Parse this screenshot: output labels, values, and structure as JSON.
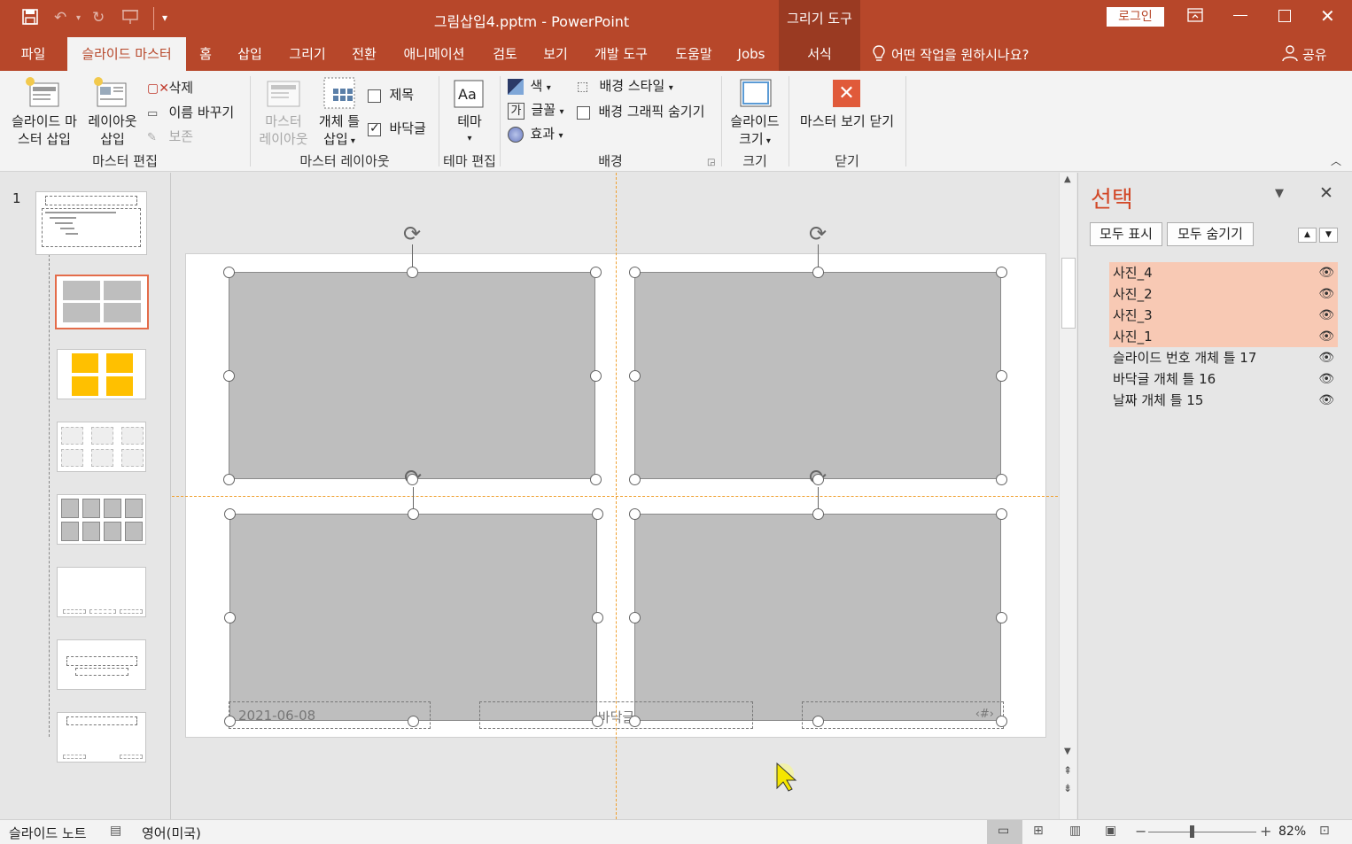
{
  "window": {
    "title": "그림삽입4.pptm  -  PowerPoint",
    "login_label": "로그인",
    "context_group": "그리기 도구"
  },
  "tabs": [
    "파일",
    "슬라이드 마스터",
    "홈",
    "삽입",
    "그리기",
    "전환",
    "애니메이션",
    "검토",
    "보기",
    "개발 도구",
    "도움말",
    "Jobs",
    "서식"
  ],
  "tell_me": "어떤 작업을 원하시나요?",
  "share": "공유",
  "ribbon": {
    "master_edit": {
      "insert_master": [
        "슬라이드 마",
        "스터 삽입"
      ],
      "insert_layout": [
        "레이아웃",
        "삽입"
      ],
      "delete": "삭제",
      "rename": "이름 바꾸기",
      "preserve": "보존",
      "label": "마스터 편집"
    },
    "master_layout": {
      "master_layout_btn": [
        "마스터",
        "레이아웃"
      ],
      "insert_placeholder": [
        "개체 틀",
        "삽입"
      ],
      "title_chk": "제목",
      "footer_chk": "바닥글",
      "label": "마스터 레이아웃"
    },
    "theme_edit": {
      "theme": "테마",
      "label": "테마 편집"
    },
    "background": {
      "colors": "색",
      "fonts": "글꼴",
      "effects": "효과",
      "bg_styles": "배경 스타일",
      "hide_bg": "배경 그래픽 숨기기",
      "label": "배경"
    },
    "size": {
      "slide_size": [
        "슬라이드",
        "크기"
      ],
      "label": "크기"
    },
    "close": {
      "close_master": "마스터 보기 닫기",
      "label": "닫기"
    }
  },
  "thumbs": {
    "number": "1"
  },
  "slide": {
    "date": "2021-06-08",
    "footer": "바닥글",
    "slide_num": "‹#›"
  },
  "selection_pane": {
    "title": "선택",
    "show_all": "모두 표시",
    "hide_all": "모두 숨기기",
    "items": [
      {
        "name": "사진_4",
        "selected": true
      },
      {
        "name": "사진_2",
        "selected": true
      },
      {
        "name": "사진_3",
        "selected": true
      },
      {
        "name": "사진_1",
        "selected": true
      },
      {
        "name": "슬라이드 번호 개체 틀 17",
        "selected": false
      },
      {
        "name": "바닥글 개체 틀 16",
        "selected": false
      },
      {
        "name": "날짜 개체 틀 15",
        "selected": false
      }
    ]
  },
  "status": {
    "notes": "슬라이드 노트",
    "language": "영어(미국)",
    "zoom": "82%"
  },
  "colors": {
    "accent": "#b7472a",
    "highlight": "#f8c9b4",
    "picture": "#bebebe"
  }
}
